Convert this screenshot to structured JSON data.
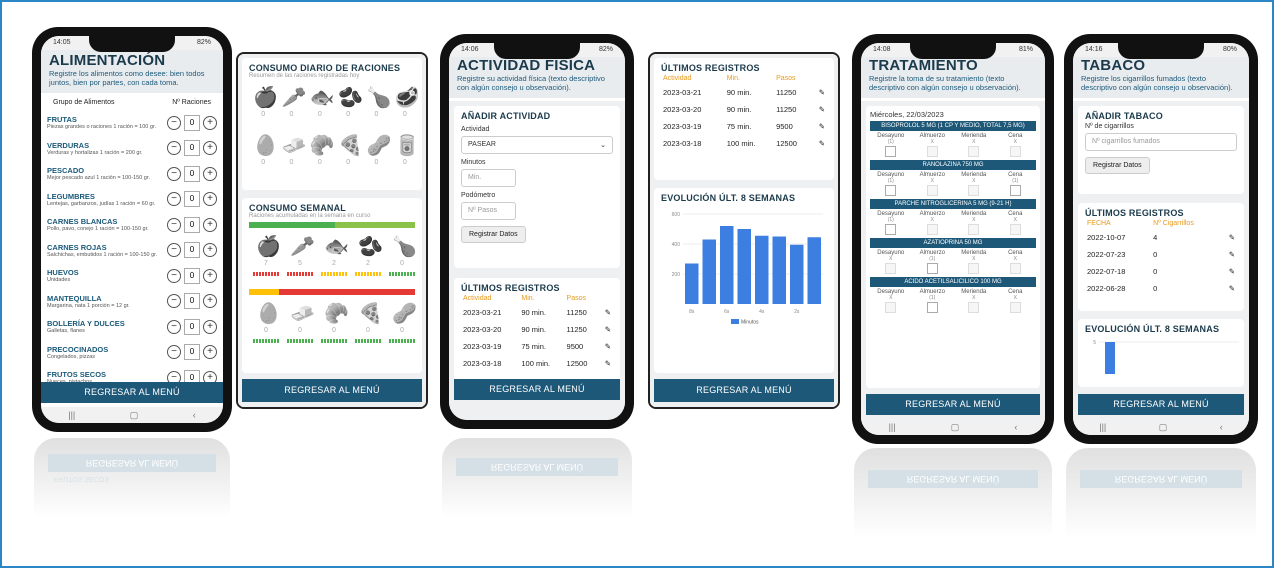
{
  "status": {
    "p1_time": "14:05",
    "p1_batt": "82%",
    "p3_time": "14:06",
    "p3_batt": "82%",
    "p5_time": "14:08",
    "p5_batt": "81%",
    "p6_time": "14:16",
    "p6_batt": "80%"
  },
  "alimentacion": {
    "title": "ALIMENTACIÓN",
    "desc": "Registre los alimentos como desee: bien todos juntos, bien por partes, con cada toma.",
    "col_group": "Grupo de Alimentos",
    "col_rations": "Nº Raciones",
    "items": [
      {
        "name": "FRUTAS",
        "desc": "Piezas grandes o raciones 1 ración = 100 gr.",
        "value": "0"
      },
      {
        "name": "VERDURAS",
        "desc": "Verduras y hortalizas 1 ración = 200 gr.",
        "value": "0"
      },
      {
        "name": "PESCADO",
        "desc": "Mejor pescado azul 1 ración = 100-150 gr.",
        "value": "0"
      },
      {
        "name": "LEGUMBRES",
        "desc": "Lentejas, garbanzos, judías 1 ración = 60 gr.",
        "value": "0"
      },
      {
        "name": "CARNES BLANCAS",
        "desc": "Pollo, pavo, conejo 1 ración = 100-150 gr.",
        "value": "0"
      },
      {
        "name": "CARNES ROJAS",
        "desc": "Salchichas, embutidos 1 ración = 100-150 gr.",
        "value": "0"
      },
      {
        "name": "HUEVOS",
        "desc": "Unidades",
        "value": "0"
      },
      {
        "name": "MANTEQUILLA",
        "desc": "Margarina, nata 1 porción = 12 gr.",
        "value": "0"
      },
      {
        "name": "BOLLERÍA Y DULCES",
        "desc": "Galletas, flanes",
        "value": "0"
      },
      {
        "name": "PRECOCINADOS",
        "desc": "Congelados, pizzas",
        "value": "0"
      },
      {
        "name": "FRUTOS SECOS",
        "desc": "Nueces, pistachos",
        "value": "0"
      }
    ],
    "back": "REGRESAR AL MENÚ"
  },
  "consumo": {
    "daily_title": "CONSUMO DIARIO DE RACIONES",
    "daily_sub": "Resumen de las raciones registradas hoy",
    "daily_row1": [
      "0",
      "0",
      "0",
      "0",
      "0",
      "0"
    ],
    "daily_row2": [
      "0",
      "0",
      "0",
      "0",
      "0",
      "0"
    ],
    "weekly_title": "CONSUMO SEMANAL",
    "weekly_sub": "Raciones acumuladas en la semana en curso",
    "weekly_row1": [
      "7",
      "5",
      "2",
      "2",
      "0"
    ],
    "weekly_row2": [
      "0",
      "0",
      "0",
      "0",
      "0"
    ],
    "back": "REGRESAR AL MENÚ"
  },
  "actividad": {
    "title": "ACTIVIDAD FÍSICA",
    "desc": "Registre su actividad física (texto descriptivo con algún consejo u observación).",
    "add_title": "AÑADIR ACTIVIDAD",
    "lbl_activity": "Actividad",
    "activity_value": "PASEAR",
    "lbl_minutes": "Minutos",
    "ph_minutes": "Min.",
    "lbl_pedometer": "Podómetro",
    "ph_steps": "Nº Pasos",
    "submit": "Registrar Datos",
    "reg_title": "ÚLTIMOS REGISTROS",
    "headers": [
      "Actividad",
      "Min.",
      "Pasos"
    ],
    "rows": [
      [
        "2023-03-21",
        "90 min.",
        "11250"
      ],
      [
        "2023-03-20",
        "90 min.",
        "11250"
      ],
      [
        "2023-03-19",
        "75 min.",
        "9500"
      ],
      [
        "2023-03-18",
        "100 min.",
        "12500"
      ]
    ],
    "back": "REGRESAR AL MENÚ"
  },
  "registros": {
    "title": "ÚLTIMOS REGISTROS",
    "headers": [
      "Actividad",
      "Min.",
      "Pasos"
    ],
    "rows": [
      [
        "2023-03-21",
        "90 min.",
        "11250"
      ],
      [
        "2023-03-20",
        "90 min.",
        "11250"
      ],
      [
        "2023-03-19",
        "75 min.",
        "9500"
      ],
      [
        "2023-03-18",
        "100 min.",
        "12500"
      ]
    ],
    "chart_title": "EVOLUCIÓN ÚLT. 8 SEMANAS",
    "back": "REGRESAR AL MENÚ"
  },
  "chart_data": [
    {
      "type": "bar",
      "title": "EVOLUCIÓN ÚLT. 8 SEMANAS",
      "yticks": [
        "600",
        "400",
        "200"
      ],
      "xticks": [
        "8s",
        "6s",
        "4s",
        "2s"
      ],
      "ylim": [
        0,
        600
      ],
      "values": [
        270,
        430,
        520,
        500,
        455,
        450,
        395,
        445
      ],
      "series": [
        {
          "name": "Minutos"
        }
      ],
      "color": "#3d7fe0"
    },
    {
      "type": "bar",
      "title": "EVOLUCIÓN ÚLT. 8 SEMANAS",
      "yticks": [
        "5"
      ],
      "ylim": [
        0,
        5
      ],
      "values": [
        5
      ],
      "color": "#3d7fe0"
    }
  ],
  "tratamiento": {
    "title": "TRATAMIENTO",
    "desc": "Registre la toma de su tratamiento (texto descriptivo con algún consejo u observación).",
    "date": "Miércoles, 22/03/2023",
    "slot_names": [
      "Desayuno",
      "Almuerzo",
      "Merienda",
      "Cena"
    ],
    "meds": [
      {
        "name": "BISOPROLOL 5 MG (1 CP Y MEDIO, TOTAL 7,5 MG)",
        "marks": [
          "(1)",
          "X",
          "X",
          "X"
        ]
      },
      {
        "name": "RANOLAZINA 750 MG",
        "marks": [
          "(1)",
          "X",
          "X",
          "(1)"
        ]
      },
      {
        "name": "PARCHE NITROGLICERINA 5 MG (9-21 H)",
        "marks": [
          "(1)",
          "X",
          "X",
          "X"
        ]
      },
      {
        "name": "AZATIOPRINA 50 MG",
        "marks": [
          "X",
          "(1)",
          "X",
          "X"
        ]
      },
      {
        "name": "ACIDO ACETILSALICILICO 100 MG",
        "marks": [
          "X",
          "(1)",
          "X",
          "X"
        ]
      }
    ],
    "back": "REGRESAR AL MENÚ"
  },
  "tabaco": {
    "title": "TABACO",
    "desc": "Registre los cigarrillos fumados (texto descriptivo con algún consejo u observación).",
    "add_title": "AÑADIR TABACO",
    "lbl": "Nº de cigarrillos",
    "placeholder": "Nº cigarrillos fumados",
    "submit": "Registrar Datos",
    "reg_title": "ÚLTIMOS REGISTROS",
    "headers": [
      "FECHA",
      "Nº Cigarrillos"
    ],
    "rows": [
      [
        "2022-10-07",
        "4"
      ],
      [
        "2022-07-23",
        "0"
      ],
      [
        "2022-07-18",
        "0"
      ],
      [
        "2022-06-28",
        "0"
      ]
    ],
    "chart_title": "EVOLUCIÓN ÚLT. 8 SEMANAS",
    "back": "REGRESAR AL MENÚ"
  },
  "reflections": {
    "r1": "REGRESAR AL MENÚ",
    "r1b": "FRUTOS SECOS",
    "r3": "REGRESAR AL MENÚ",
    "r5": "REGRESAR AL MENÚ",
    "r6": "REGRESAR AL MENÚ"
  }
}
